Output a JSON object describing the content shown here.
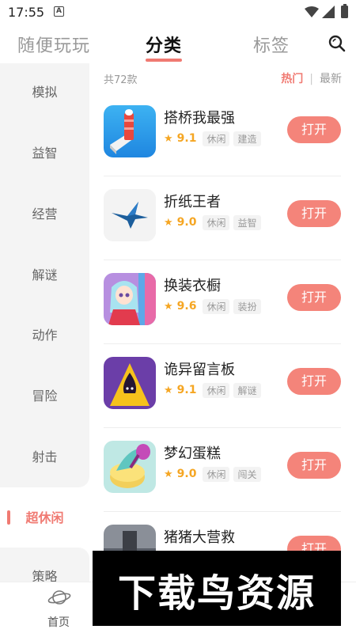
{
  "status_bar": {
    "time": "17:55",
    "notification_icon_letter": "A"
  },
  "top_nav": {
    "tabs": [
      {
        "label": "随便玩玩",
        "active": false
      },
      {
        "label": "分类",
        "active": true
      },
      {
        "label": "标签",
        "active": false
      }
    ],
    "accent_color": "#f07a72"
  },
  "sidebar": {
    "items": [
      {
        "label": "模拟",
        "active": false
      },
      {
        "label": "益智",
        "active": false
      },
      {
        "label": "经营",
        "active": false
      },
      {
        "label": "解谜",
        "active": false
      },
      {
        "label": "动作",
        "active": false
      },
      {
        "label": "冒险",
        "active": false
      },
      {
        "label": "射击",
        "active": false
      },
      {
        "label": "超休闲",
        "active": true
      },
      {
        "label": "策略",
        "active": false
      }
    ]
  },
  "list_header": {
    "count_label": "共72款",
    "sort_hot": "热门",
    "sort_divider": "|",
    "sort_new": "最新"
  },
  "apps": [
    {
      "name": "搭桥我最强",
      "rating": "9.1",
      "tags": [
        "休闲",
        "建造"
      ],
      "button": "打开",
      "icon": "bridge-game-icon"
    },
    {
      "name": "折纸王者",
      "rating": "9.0",
      "tags": [
        "休闲",
        "益智"
      ],
      "button": "打开",
      "icon": "paper-bird-icon"
    },
    {
      "name": "换装衣橱",
      "rating": "9.6",
      "tags": [
        "休闲",
        "装扮"
      ],
      "button": "打开",
      "icon": "dress-up-girl-icon"
    },
    {
      "name": "诡异留言板",
      "rating": "9.1",
      "tags": [
        "休闲",
        "解谜"
      ],
      "button": "打开",
      "icon": "yellow-raincoat-icon"
    },
    {
      "name": "梦幻蛋糕",
      "rating": "9.0",
      "tags": [
        "休闲",
        "闯关"
      ],
      "button": "打开",
      "icon": "cake-icon"
    },
    {
      "name": "猪猪大营救",
      "rating": "",
      "tags": [],
      "button": "打开",
      "icon": "rescue-game-icon"
    }
  ],
  "bottom_nav": {
    "home_label": "首页"
  },
  "watermark": {
    "text": "下载鸟资源"
  }
}
